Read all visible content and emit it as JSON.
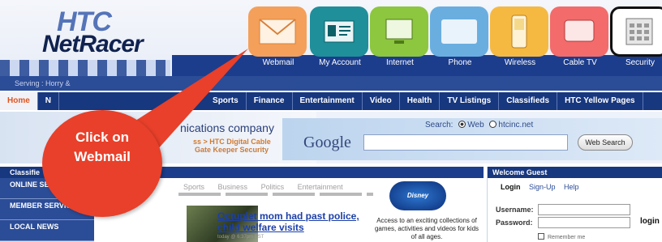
{
  "brand": {
    "mark": "HTC",
    "name": "NetRacer"
  },
  "services": [
    {
      "label": "Webmail",
      "icon": "envelope-icon",
      "color": "#f4a05a"
    },
    {
      "label": "My Account",
      "icon": "id-card-icon",
      "color": "#1f8f9a"
    },
    {
      "label": "Internet",
      "icon": "monitor-icon",
      "color": "#8dc63f"
    },
    {
      "label": "Phone",
      "icon": "phone-card-icon",
      "color": "#6aaee0"
    },
    {
      "label": "Wireless",
      "icon": "mobile-phone-icon",
      "color": "#f5b942"
    },
    {
      "label": "Cable TV",
      "icon": "tv-icon",
      "color": "#f36b6b"
    },
    {
      "label": "Security",
      "icon": "keypad-icon",
      "color": "#b8b8b8"
    }
  ],
  "serving": "Serving : Horry &",
  "nav": {
    "home": "Home",
    "partial": "N",
    "items": [
      "Sports",
      "Finance",
      "Entertainment",
      "Video",
      "Health",
      "TV Listings",
      "Classifieds",
      "HTC Yellow Pages"
    ]
  },
  "banner": {
    "title": "nications company",
    "links": "ss > HTC Digital Cable",
    "sub": "Gate Keeper Security"
  },
  "search": {
    "label": "Search:",
    "option_web": "Web",
    "option_site": "htcinc.net",
    "engine": "Google",
    "button": "Web Search",
    "query": ""
  },
  "left": {
    "header": "Classifie",
    "items": [
      "ONLINE SERVICES",
      "MEMBER SERVICES",
      "LOCAL NEWS"
    ]
  },
  "news": {
    "tabs": [
      "Sports",
      "Business",
      "Politics",
      "Entertainment"
    ],
    "story_title": "Octuplet mom had past police, child welfare visits",
    "story_time": "today @ 6:37pm EST"
  },
  "promo": {
    "logo": "Disney Connection",
    "text": "Access to an exciting collections of games, activities and videos for kids of all ages."
  },
  "login": {
    "header": "Welcome Guest",
    "tabs": [
      "Login",
      "Sign-Up",
      "Help"
    ],
    "username_label": "Username:",
    "password_label": "Password:",
    "button": "login",
    "remember": "Remember me"
  },
  "callout": {
    "line1": "Click on",
    "line2": "Webmail",
    "color": "#e8402a"
  }
}
